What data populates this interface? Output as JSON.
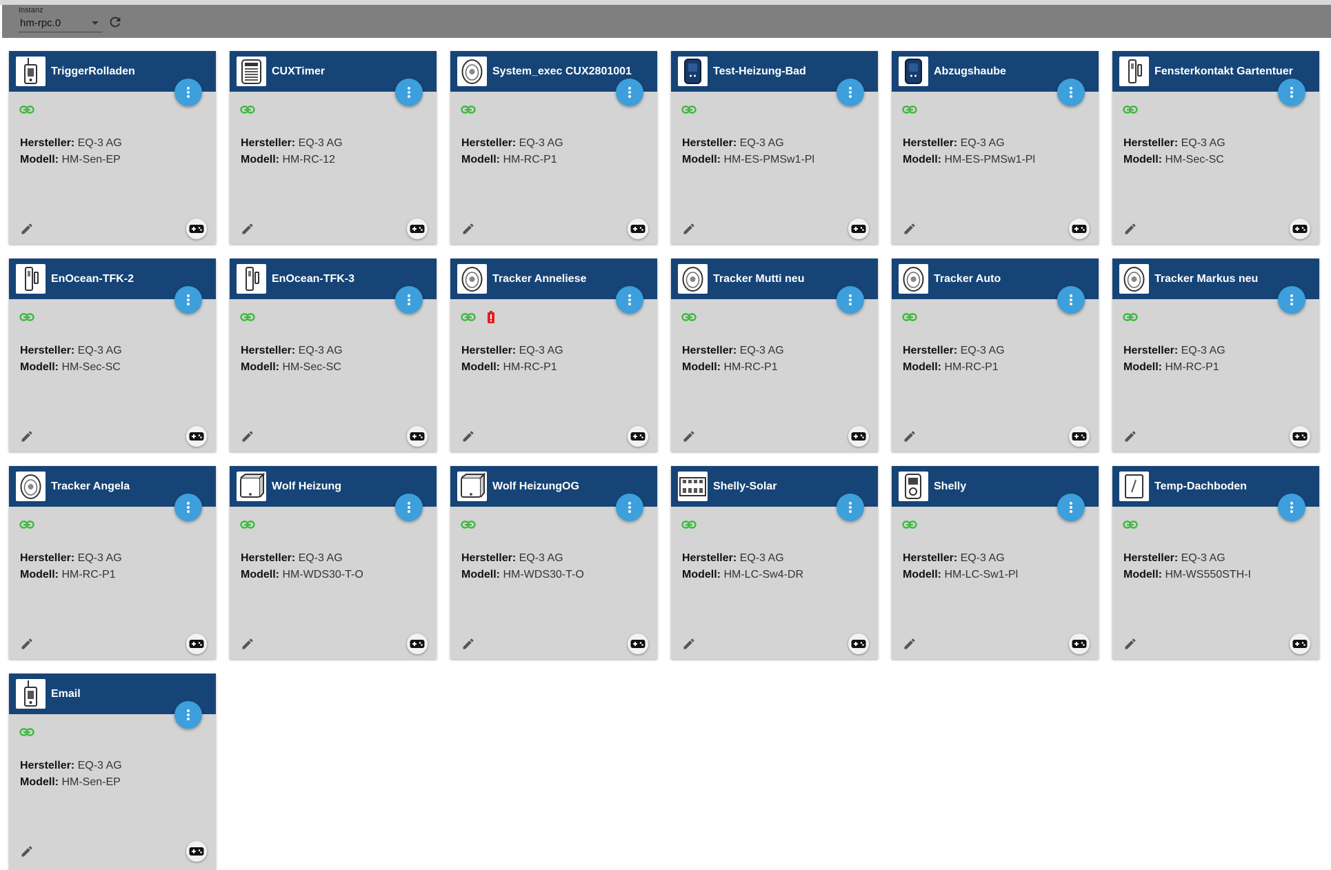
{
  "toolbar": {
    "instance_label": "Instanz",
    "instance_value": "hm-rpc.0"
  },
  "labels": {
    "manufacturer": "Hersteller:",
    "model": "Modell:"
  },
  "devices": [
    {
      "name": "TriggerRolladen",
      "manufacturer": "EQ-3 AG",
      "model": "HM-Sen-EP",
      "image": "sensor-ep-icon",
      "battery_warning": false
    },
    {
      "name": "CUXTimer",
      "manufacturer": "EQ-3 AG",
      "model": "HM-RC-12",
      "image": "remote-12-icon",
      "battery_warning": false
    },
    {
      "name": "System_exec CUX2801001",
      "manufacturer": "EQ-3 AG",
      "model": "HM-RC-P1",
      "image": "tracker-icon",
      "battery_warning": false
    },
    {
      "name": "Test-Heizung-Bad",
      "manufacturer": "EQ-3 AG",
      "model": "HM-ES-PMSw1-Pl",
      "image": "plug-icon",
      "battery_warning": false
    },
    {
      "name": "Abzugshaube",
      "manufacturer": "EQ-3 AG",
      "model": "HM-ES-PMSw1-Pl",
      "image": "plug-icon",
      "battery_warning": false
    },
    {
      "name": "Fensterkontakt Gartentuer",
      "manufacturer": "EQ-3 AG",
      "model": "HM-Sec-SC",
      "image": "contact-icon",
      "battery_warning": false
    },
    {
      "name": "EnOcean-TFK-2",
      "manufacturer": "EQ-3 AG",
      "model": "HM-Sec-SC",
      "image": "contact-icon",
      "battery_warning": false
    },
    {
      "name": "EnOcean-TFK-3",
      "manufacturer": "EQ-3 AG",
      "model": "HM-Sec-SC",
      "image": "contact-icon",
      "battery_warning": false
    },
    {
      "name": "Tracker Anneliese",
      "manufacturer": "EQ-3 AG",
      "model": "HM-RC-P1",
      "image": "tracker-icon",
      "battery_warning": true
    },
    {
      "name": "Tracker Mutti neu",
      "manufacturer": "EQ-3 AG",
      "model": "HM-RC-P1",
      "image": "tracker-icon",
      "battery_warning": false
    },
    {
      "name": "Tracker Auto",
      "manufacturer": "EQ-3 AG",
      "model": "HM-RC-P1",
      "image": "tracker-icon",
      "battery_warning": false
    },
    {
      "name": "Tracker Markus neu",
      "manufacturer": "EQ-3 AG",
      "model": "HM-RC-P1",
      "image": "tracker-icon",
      "battery_warning": false
    },
    {
      "name": "Tracker Angela",
      "manufacturer": "EQ-3 AG",
      "model": "HM-RC-P1",
      "image": "tracker-icon",
      "battery_warning": false
    },
    {
      "name": "Wolf Heizung",
      "manufacturer": "EQ-3 AG",
      "model": "HM-WDS30-T-O",
      "image": "box-sensor-icon",
      "battery_warning": false
    },
    {
      "name": "Wolf HeizungOG",
      "manufacturer": "EQ-3 AG",
      "model": "HM-WDS30-T-O",
      "image": "box-sensor-icon",
      "battery_warning": false
    },
    {
      "name": "Shelly-Solar",
      "manufacturer": "EQ-3 AG",
      "model": "HM-LC-Sw4-DR",
      "image": "din-rail-icon",
      "battery_warning": false
    },
    {
      "name": "Shelly",
      "manufacturer": "EQ-3 AG",
      "model": "HM-LC-Sw1-Pl",
      "image": "switch-plug-icon",
      "battery_warning": false
    },
    {
      "name": "Temp-Dachboden",
      "manufacturer": "EQ-3 AG",
      "model": "HM-WS550STH-I",
      "image": "thermo-icon",
      "battery_warning": false
    },
    {
      "name": "Email",
      "manufacturer": "EQ-3 AG",
      "model": "HM-Sen-EP",
      "image": "sensor-ep-icon",
      "battery_warning": false
    }
  ],
  "colors": {
    "header_bg": "#164477",
    "card_bg": "#d4d4d4",
    "menu_btn": "#3d9fdc",
    "link_ok": "#3dbb3d",
    "battery_low": "#e02020",
    "toolbar_bg": "#7f7f7f"
  },
  "icons": {
    "link": "link-icon",
    "battery": "battery-alert-icon",
    "menu": "more-vert-icon",
    "edit": "pencil-icon",
    "control": "gamepad-icon",
    "refresh": "refresh-icon",
    "dropdown": "chevron-down-icon"
  }
}
